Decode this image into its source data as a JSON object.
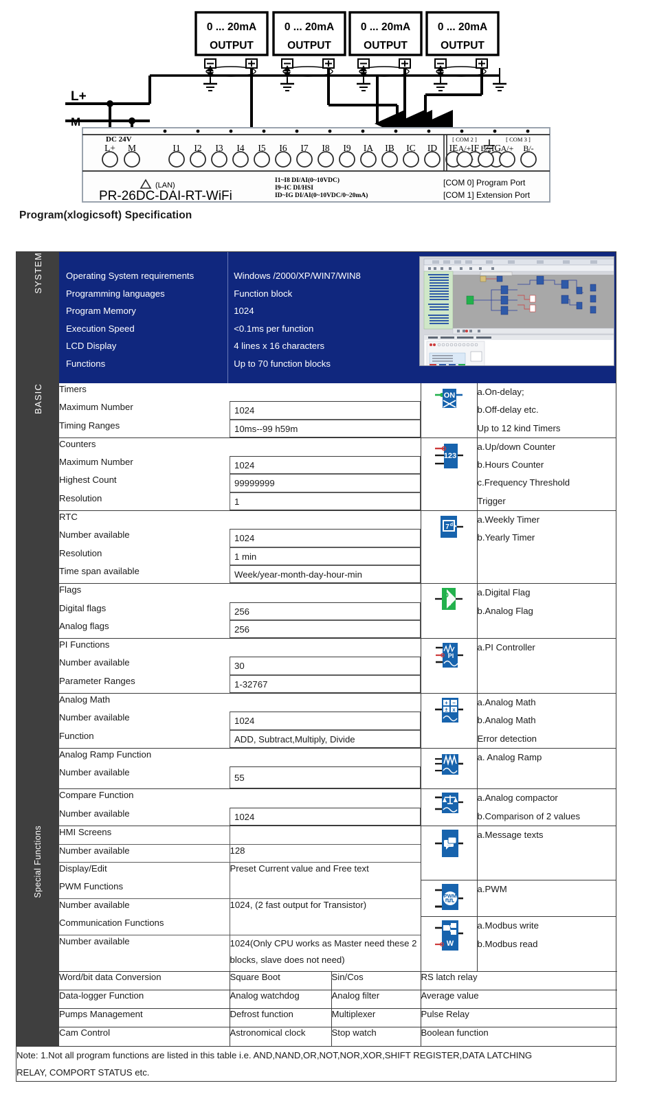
{
  "wiring": {
    "outputs": [
      {
        "range": "0 ... 20mA",
        "label": "OUTPUT"
      },
      {
        "range": "0 ... 20mA",
        "label": "OUTPUT"
      },
      {
        "range": "0 ... 20mA",
        "label": "OUTPUT"
      },
      {
        "range": "0 ... 20mA",
        "label": "OUTPUT"
      }
    ],
    "supply": {
      "l_plus": "L+",
      "m": "M"
    },
    "power_caption": {
      "line1": "DC  24V",
      "terminals": [
        "L+",
        "M"
      ]
    },
    "input_terminals": [
      "I1",
      "I2",
      "I3",
      "I4",
      "I5",
      "I6",
      "I7",
      "I8",
      "I9",
      "IA",
      "IB",
      "IC",
      "ID",
      "IE",
      "IF",
      "IG"
    ],
    "com2": {
      "title": "[ COM 2 ]",
      "pins": [
        "A/+",
        "B/-"
      ]
    },
    "com3": {
      "title": "[ COM 3 ]",
      "pins": [
        "A/+",
        "B/-"
      ]
    },
    "ground_symbol": "earth-ground",
    "lan_label": "(LAN)",
    "model": "PR-26DC-DAI-RT-WiFi",
    "io_notes": [
      "I1~I8 DI/AI(0~10VDC)",
      "I9~IC DI/HSI",
      "ID~IG DI/AI(0~10VDC/0~20mA)"
    ],
    "port_notes": [
      "[COM 0] Program Port",
      "[COM 1] Extension Port"
    ]
  },
  "heading": "Program(xlogicsoft) Specification",
  "colors": {
    "system_bg": "#10277e",
    "label_bg": "#3f3f3f",
    "icon_blue": "#1763ad",
    "icon_green": "#22b14c",
    "border": "#3b3b3b"
  },
  "sections": {
    "system": {
      "label": "SYSTEM",
      "rows": [
        {
          "label": "Operating System requirements",
          "value": "Windows /2000/XP/WIN7/WIN8"
        },
        {
          "label": "Programming languages",
          "value": "Function block"
        },
        {
          "label": "Program Memory",
          "value": "1024"
        },
        {
          "label": "Execution Speed",
          "value": "<0.1ms per function"
        },
        {
          "label": "LCD Display",
          "value": "4 lines x 16 characters"
        },
        {
          "label": "Functions",
          "value": "Up to 70 function blocks"
        }
      ],
      "screenshot_alt": "xlogicsoft function block editor screenshot"
    },
    "basic": {
      "label": "BASIC",
      "groups": [
        {
          "icon": "timer-on-delay-icon",
          "icon_color": "#1763ad",
          "rows": [
            {
              "label": "Timers",
              "value": null
            },
            {
              "label": "Maximum Number",
              "value": "1024"
            },
            {
              "label": "Timing Ranges",
              "value": "10ms--99 h59m"
            }
          ],
          "desc": [
            "a.On-delay;",
            "b.Off-delay etc.",
            "Up to 12 kind Timers"
          ]
        },
        {
          "icon": "counter-123-icon",
          "icon_color": "#1763ad",
          "rows": [
            {
              "label": "Counters",
              "value": null
            },
            {
              "label": "Maximum Number",
              "value": "1024"
            },
            {
              "label": "Highest Count",
              "value": "99999999"
            },
            {
              "label": "Resolution",
              "value": "1"
            }
          ],
          "desc": [
            "a.Up/down Counter",
            "b.Hours Counter",
            "c.Frequency Threshold",
            "   Trigger"
          ]
        },
        {
          "icon": "weekly-timer-7d-icon",
          "icon_color": "#1763ad",
          "rows": [
            {
              "label": "RTC",
              "value": null
            },
            {
              "label": "Number available",
              "value": "1024"
            },
            {
              "label": "Resolution",
              "value": "1 min"
            },
            {
              "label": "Time span available",
              "value": "Week/year-month-day-hour-min"
            }
          ],
          "desc": [
            "a.Weekly Timer",
            "b.Yearly Timer"
          ]
        },
        {
          "icon": "digital-flag-icon",
          "icon_color": "#22b14c",
          "rows": [
            {
              "label": "Flags",
              "value": null
            },
            {
              "label": "Digital flags",
              "value": "256"
            },
            {
              "label": "Analog flags",
              "value": "256"
            }
          ],
          "desc": [
            "a.Digital Flag",
            "b.Analog Flag"
          ]
        },
        {
          "icon": "pi-controller-icon",
          "icon_color": "#1763ad",
          "rows": [
            {
              "label": "PI Functions",
              "value": null
            },
            {
              "label": "Number available",
              "value": "30"
            },
            {
              "label": "Parameter Ranges",
              "value": "1-32767"
            }
          ],
          "desc": [
            "a.PI Controller"
          ]
        },
        {
          "icon": "analog-math-icon",
          "icon_color": "#1763ad",
          "rows": [
            {
              "label": "Analog Math",
              "value": null
            },
            {
              "label": "Number available",
              "value": "1024"
            },
            {
              "label": "Function",
              "value": "ADD, Subtract,Multiply, Divide"
            }
          ],
          "desc": [
            "a.Analog Math",
            "b.Analog Math",
            "   Error detection"
          ]
        },
        {
          "icon": "analog-ramp-icon",
          "icon_color": "#1763ad",
          "rows": [
            {
              "label": "Analog Ramp Function",
              "value": null
            },
            {
              "label": "Number available",
              "value": "55"
            }
          ],
          "desc": [
            "a. Analog Ramp"
          ]
        },
        {
          "icon": "analog-comparator-icon",
          "icon_color": "#1763ad",
          "rows": [
            {
              "label": "Compare Function",
              "value": null
            },
            {
              "label": "Number available",
              "value": "1024"
            }
          ],
          "desc": [
            "a.Analog compactor",
            "b.Comparison of 2 values"
          ]
        }
      ]
    },
    "special": {
      "label": "Special Functions",
      "groups": [
        {
          "icon": "message-text-icon",
          "icon_color": "#1763ad",
          "rows": [
            {
              "label": "HMI Screens",
              "value": ""
            },
            {
              "label": "Number available",
              "value": "128"
            },
            {
              "label": "Display/Edit",
              "value": "Preset Current value and Free text"
            }
          ],
          "desc": [
            "a.Message texts"
          ]
        },
        {
          "icon": "pwm-icon",
          "icon_color": "#1763ad",
          "rows": [
            {
              "label": "PWM Functions",
              "value": ""
            },
            {
              "label": "Number available",
              "value": "1024,        (2 fast output for Transistor)"
            }
          ],
          "desc": [
            "a.PWM"
          ]
        },
        {
          "icon": "modbus-icon",
          "icon_color": "#1763ad",
          "rows": [
            {
              "label": "Communication Functions",
              "value": ""
            },
            {
              "label": "Number available",
              "value": "1024(Only CPU works as Master need these 2 blocks, slave does not need)"
            }
          ],
          "desc": [
            "a.Modbus write",
            "b.Modbus read"
          ]
        }
      ],
      "matrix": [
        [
          "Word/bit data Conversion",
          "Square Boot",
          "Sin/Cos",
          "RS latch relay"
        ],
        [
          "Data-logger Function",
          "Analog watchdog",
          "Analog filter",
          "Average value"
        ],
        [
          "Pumps Management",
          "Defrost function",
          "Multiplexer",
          "Pulse Relay"
        ],
        [
          "Cam Control",
          "Astronomical clock",
          "Stop watch",
          "Boolean function"
        ]
      ]
    }
  },
  "note": {
    "line1": "Note: 1.Not all program functions are listed in this table i.e. AND,NAND,OR,NOT,NOR,XOR,SHIFT REGISTER,DATA LATCHING",
    "line2": "RELAY, COMPORT STATUS etc."
  }
}
